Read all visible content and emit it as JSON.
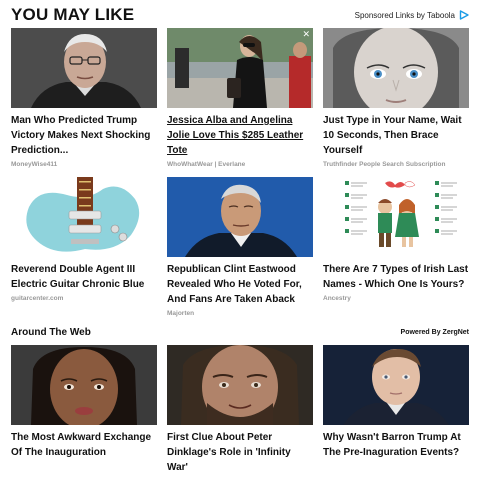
{
  "header": {
    "title": "YOU MAY LIKE",
    "sponsor_label": "Sponsored Links by Taboola"
  },
  "cards_top": [
    {
      "title": "Man Who Predicted Trump Victory Makes Next Shocking Prediction...",
      "source": "MoneyWise411",
      "image": "man-with-glasses-photo"
    },
    {
      "title": "Jessica Alba and Angelina Jolie Love This $285 Leather Tote",
      "source": "WhoWhatWear | Everlane",
      "image": "woman-walking-street-photo"
    },
    {
      "title": "Just Type in Your Name, Wait 10 Seconds, Then Brace Yourself",
      "source": "Truthfinder People Search Subscription",
      "image": "blue-eyed-woman-photo"
    }
  ],
  "cards_mid": [
    {
      "title": "Reverend Double Agent III Electric Guitar Chronic Blue",
      "source": "guitarcenter.com",
      "image": "blue-electric-guitar-photo"
    },
    {
      "title": "Republican Clint Eastwood Revealed Who He Voted For, And Fans Are Taken Aback",
      "source": "Majorten",
      "image": "clint-eastwood-photo"
    },
    {
      "title": "There Are 7 Types of Irish Last Names - Which One Is Yours?",
      "source": "Ancestry",
      "image": "irish-names-illustration"
    }
  ],
  "section": {
    "title": "Around The Web",
    "powered_by": "Powered By ZergNet"
  },
  "cards_bottom": [
    {
      "title": "The Most Awkward Exchange Of The Inauguration",
      "image": "woman-face-photo"
    },
    {
      "title": "First Clue About Peter Dinklage's Role in 'Infinity War'",
      "image": "peter-dinklage-photo"
    },
    {
      "title": "Why Wasn't Barron Trump At The Pre-Inaguration Events?",
      "image": "boy-face-photo"
    }
  ],
  "colors": {
    "taboola_blue": "#1a9be6",
    "source_gray": "#999999"
  }
}
